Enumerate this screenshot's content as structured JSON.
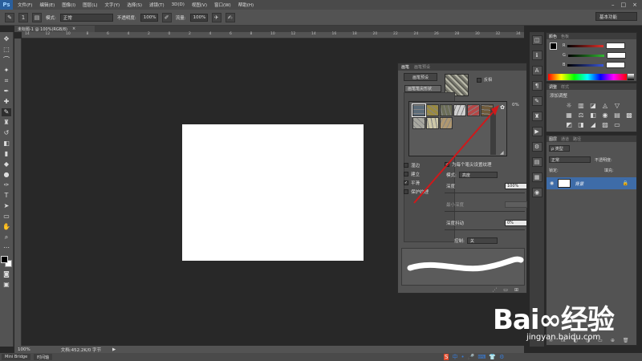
{
  "menubar": {
    "logo": "Ps",
    "items": [
      "文件(F)",
      "编辑(E)",
      "图像(I)",
      "图层(L)",
      "文字(Y)",
      "选择(S)",
      "滤镜(T)",
      "3D(D)",
      "视图(V)",
      "窗口(W)",
      "帮助(H)"
    ],
    "window_controls": [
      "–",
      "□",
      "×"
    ]
  },
  "options": {
    "mode_label": "模式:",
    "mode_value": "正常",
    "opacity_label": "不透明度:",
    "opacity_value": "100%",
    "flow_label": "流量:",
    "flow_value": "100%",
    "brush_size": "1",
    "workspace": "基本功能"
  },
  "document": {
    "tab_title": "未标题-1 @ 100%(RGB/8)",
    "tab_close": "×",
    "zoom": "100%",
    "doc_info": "文档:452.2K/0 字节"
  },
  "rulers": {
    "h_ticks": [
      "14",
      "12",
      "10",
      "8",
      "6",
      "4",
      "2",
      "0",
      "2",
      "4",
      "6",
      "8",
      "10",
      "12",
      "14",
      "16",
      "18",
      "20",
      "22",
      "24",
      "26",
      "28",
      "30",
      "32",
      "34"
    ]
  },
  "bottom_tabs": [
    "Mini Bridge",
    "时间轴"
  ],
  "color_panel": {
    "tabs": [
      "颜色",
      "色板"
    ],
    "channels": [
      {
        "label": "R",
        "color": "#e0302a"
      },
      {
        "label": "G",
        "color": "#32b832"
      },
      {
        "label": "B",
        "color": "#3a56d8"
      }
    ]
  },
  "adjust_panel": {
    "tabs": [
      "调整",
      "样式"
    ],
    "title": "添加调整",
    "icons": [
      "☼",
      "▥",
      "◪",
      "◬",
      "▽",
      "",
      "▦",
      "⚖",
      "◧",
      "◉",
      "▤",
      "▩",
      "◩",
      "◨",
      "◢",
      "▨",
      "▭",
      ""
    ]
  },
  "layers_panel": {
    "tabs": [
      "图层",
      "通道",
      "路径"
    ],
    "kind_label": "ρ 类型",
    "blend_mode": "正常",
    "opacity_label": "不透明度:",
    "lock_label": "锁定:",
    "fill_label": "填充:",
    "layer_name": "背景",
    "footer_icons": [
      "∞",
      "fx",
      "◐",
      "◑",
      "▭",
      "⊕",
      "🗑"
    ]
  },
  "brush_panel": {
    "tabs": [
      "画笔",
      "画笔预设"
    ],
    "presets_button": "画笔预设",
    "tip_shape": "画笔笔尖形状",
    "flip_label": "反相",
    "options": [
      {
        "label": "湿边",
        "checked": false
      },
      {
        "label": "建立",
        "checked": false
      },
      {
        "label": "平滑",
        "checked": true
      },
      {
        "label": "保护纹理",
        "checked": false
      }
    ],
    "texture_each_label": "为每个笔尖设置纹理",
    "mode_label": "模式:",
    "mode_value": "高度",
    "depth_label": "深度",
    "depth_value": "100%",
    "min_depth_label": "最小深度",
    "depth_jitter_label": "深度抖动",
    "depth_jitter_value": "0%",
    "control_label": "控制:",
    "control_value": "关",
    "percent_top": "0%"
  },
  "texture_popup": {
    "swatches": [
      "#5b6b78",
      "#9a8a40",
      "#6c6e58",
      "#cfcfcf",
      "#b54848",
      "#6f5a3a",
      "#a8a8a0",
      "#cdc8a8",
      "#b09870"
    ],
    "gear": "✿"
  },
  "watermark": {
    "logo": "Bai∞经验",
    "url": "jingyan.baidu.com"
  },
  "ime": [
    "S",
    "中",
    "•",
    "🎤",
    "⌨",
    "👕",
    "⚙"
  ],
  "arrow_color": "#d0181a"
}
